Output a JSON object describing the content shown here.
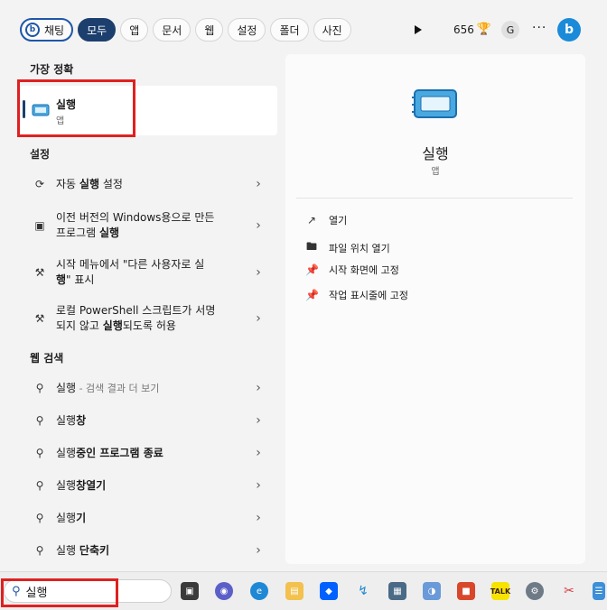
{
  "filter_bar": {
    "chat": "채팅",
    "tabs": [
      "모두",
      "앱",
      "문서",
      "웹",
      "설정",
      "폴더",
      "사진"
    ],
    "points": "656"
  },
  "avatar": "G",
  "best_match": {
    "title": "가장 정확",
    "app_name": "실행",
    "app_type": "앱"
  },
  "settings": {
    "title": "설정",
    "items": [
      {
        "pre": "자동 ",
        "bold": "실행",
        "post": " 설정"
      },
      {
        "line1": "이전 버전의 Windows용으로 만든",
        "line2_pre": "프로그램 ",
        "line2_bold": "실행",
        "line2_post": ""
      },
      {
        "line1": "시작 메뉴에서 \"다른 사용자로 실",
        "line2_pre": "",
        "line2_bold": "행",
        "line2_post": "\" 표시"
      },
      {
        "line1": "로컬 PowerShell 스크립트가 서명",
        "line2_pre": "되지 않고 ",
        "line2_bold": "실행",
        "line2_post": "되도록 허용"
      }
    ]
  },
  "web": {
    "title": "웹 검색",
    "items": [
      {
        "bold": "실행",
        "post": "",
        "suffix": " - 검색 결과 더 보기"
      },
      {
        "pre": "실행",
        "bold": "창",
        "post": ""
      },
      {
        "pre": "실행",
        "bold": "중인 프로그램 종료",
        "post": ""
      },
      {
        "pre": "실행",
        "bold": "창열기",
        "post": ""
      },
      {
        "pre": "실행",
        "bold": "기",
        "post": ""
      },
      {
        "pre": "실행 ",
        "bold": "단축키",
        "post": ""
      }
    ]
  },
  "detail": {
    "name": "실행",
    "type": "앱",
    "actions": [
      "열기",
      "파일 위치 열기",
      "시작 화면에 고정",
      "작업 표시줄에 고정"
    ]
  },
  "taskbar": {
    "search_value": "실행",
    "apps": [
      "task-view",
      "teams-chat",
      "edge",
      "file-explorer",
      "dropbox",
      "powershell",
      "calculator",
      "network",
      "office",
      "kakaotalk",
      "settings",
      "snipping-tool",
      "notepad"
    ]
  },
  "colors": {
    "accent": "#1c3f6e",
    "bing_blue": "#1f56a8",
    "highlight_red": "#e02020"
  }
}
